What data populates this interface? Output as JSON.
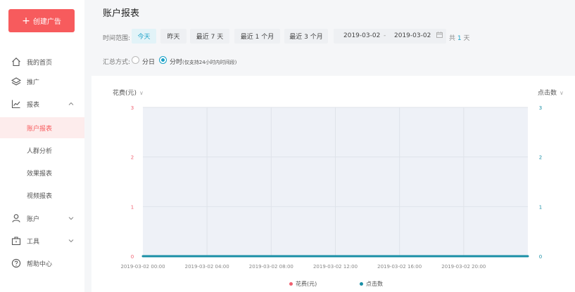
{
  "sidebar": {
    "create_button": "创建广告",
    "items": [
      {
        "label": "我的首页",
        "icon": "home-icon"
      },
      {
        "label": "推广",
        "icon": "layers-icon"
      },
      {
        "label": "报表",
        "icon": "chart-icon",
        "expanded": true
      },
      {
        "label": "账户",
        "icon": "user-icon"
      },
      {
        "label": "工具",
        "icon": "toolbox-icon"
      },
      {
        "label": "帮助中心",
        "icon": "help-icon"
      }
    ],
    "report_sub": [
      "账户报表",
      "人群分析",
      "效果报表",
      "视频报表"
    ]
  },
  "page": {
    "title": "账户报表",
    "range_label": "时间范围:",
    "ranges": [
      "今天",
      "昨天",
      "最近 7 天",
      "最近 1 个月",
      "最近 3 个月"
    ],
    "active_range": 0,
    "date_start": "2019-03-02",
    "date_sep": "-",
    "date_end": "2019-03-02",
    "day_count_prefix": "共",
    "day_count": "1",
    "day_count_suffix": "天",
    "summary_label": "汇总方式:",
    "summary_day": "分日",
    "summary_hour": "分时",
    "summary_hour_note": "(仅支持24小时内时间段)"
  },
  "colors": {
    "brand": "#f75b5d",
    "accent": "#1aa1c7",
    "series_cost": "#f06070",
    "series_clicks": "#1a8fa6"
  },
  "chart_data": {
    "type": "area",
    "y_left_label": "花费(元)",
    "y_right_label": "点击数",
    "y_ticks": [
      "0",
      "1",
      "2",
      "3"
    ],
    "ylim": [
      0,
      3
    ],
    "x": [
      "2019-03-02 00:00",
      "2019-03-02 04:00",
      "2019-03-02 08:00",
      "2019-03-02 12:00",
      "2019-03-02 16:00",
      "2019-03-02 20:00"
    ],
    "series": [
      {
        "name": "花费(元)",
        "values": [
          0,
          0,
          0,
          0,
          0,
          0
        ]
      },
      {
        "name": "点击数",
        "values": [
          0,
          0,
          0,
          0,
          0,
          0
        ]
      }
    ],
    "grid": true,
    "legend": "bottom"
  }
}
